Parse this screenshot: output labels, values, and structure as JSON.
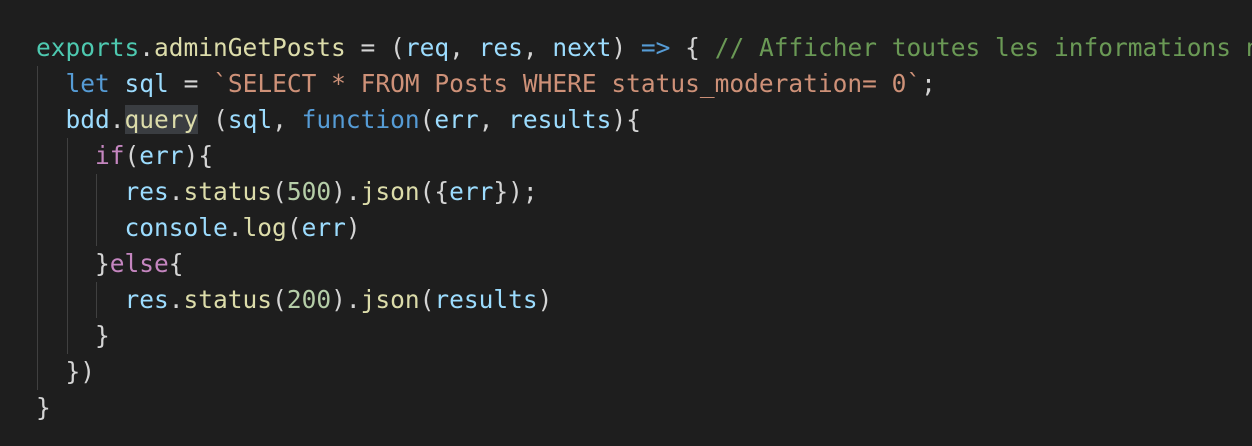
{
  "editor": {
    "background": "#1e1e1e",
    "indent_unit": "  ",
    "highlighted_token": "query",
    "lines": [
      {
        "indent": 0,
        "tokens": [
          {
            "t": "exports",
            "c": "obj"
          },
          {
            "t": ".",
            "c": "pun"
          },
          {
            "t": "adminGetPosts",
            "c": "fn"
          },
          {
            "t": " = (",
            "c": "pun"
          },
          {
            "t": "req",
            "c": "var"
          },
          {
            "t": ", ",
            "c": "pun"
          },
          {
            "t": "res",
            "c": "var"
          },
          {
            "t": ", ",
            "c": "pun"
          },
          {
            "t": "next",
            "c": "var"
          },
          {
            "t": ") ",
            "c": "pun"
          },
          {
            "t": "=>",
            "c": "kw"
          },
          {
            "t": " { ",
            "c": "pun"
          },
          {
            "t": "// Afficher toutes les informations ne",
            "c": "cm"
          }
        ]
      },
      {
        "indent": 1,
        "tokens": [
          {
            "t": "let",
            "c": "kw"
          },
          {
            "t": " ",
            "c": "pun"
          },
          {
            "t": "sql",
            "c": "var"
          },
          {
            "t": " = ",
            "c": "pun"
          },
          {
            "t": "`SELECT * FROM Posts WHERE status_moderation= 0`",
            "c": "str"
          },
          {
            "t": ";",
            "c": "pun"
          }
        ]
      },
      {
        "indent": 1,
        "tokens": [
          {
            "t": "bdd",
            "c": "var"
          },
          {
            "t": ".",
            "c": "pun"
          },
          {
            "t": "query",
            "c": "fn",
            "hl": true
          },
          {
            "t": " (",
            "c": "pun"
          },
          {
            "t": "sql",
            "c": "var"
          },
          {
            "t": ", ",
            "c": "pun"
          },
          {
            "t": "function",
            "c": "kw"
          },
          {
            "t": "(",
            "c": "pun"
          },
          {
            "t": "err",
            "c": "var"
          },
          {
            "t": ", ",
            "c": "pun"
          },
          {
            "t": "results",
            "c": "var"
          },
          {
            "t": "){",
            "c": "pun"
          }
        ]
      },
      {
        "indent": 2,
        "tokens": [
          {
            "t": "if",
            "c": "ctrl"
          },
          {
            "t": "(",
            "c": "pun"
          },
          {
            "t": "err",
            "c": "var"
          },
          {
            "t": "){",
            "c": "pun"
          }
        ]
      },
      {
        "indent": 3,
        "tokens": [
          {
            "t": "res",
            "c": "var"
          },
          {
            "t": ".",
            "c": "pun"
          },
          {
            "t": "status",
            "c": "fn"
          },
          {
            "t": "(",
            "c": "pun"
          },
          {
            "t": "500",
            "c": "num"
          },
          {
            "t": ").",
            "c": "pun"
          },
          {
            "t": "json",
            "c": "fn"
          },
          {
            "t": "({",
            "c": "pun"
          },
          {
            "t": "err",
            "c": "var"
          },
          {
            "t": "});",
            "c": "pun"
          }
        ]
      },
      {
        "indent": 3,
        "tokens": [
          {
            "t": "console",
            "c": "var"
          },
          {
            "t": ".",
            "c": "pun"
          },
          {
            "t": "log",
            "c": "fn"
          },
          {
            "t": "(",
            "c": "pun"
          },
          {
            "t": "err",
            "c": "var"
          },
          {
            "t": ")",
            "c": "pun"
          }
        ]
      },
      {
        "indent": 2,
        "tokens": [
          {
            "t": "}",
            "c": "pun"
          },
          {
            "t": "else",
            "c": "ctrl"
          },
          {
            "t": "{",
            "c": "pun"
          }
        ]
      },
      {
        "indent": 3,
        "tokens": [
          {
            "t": "res",
            "c": "var"
          },
          {
            "t": ".",
            "c": "pun"
          },
          {
            "t": "status",
            "c": "fn"
          },
          {
            "t": "(",
            "c": "pun"
          },
          {
            "t": "200",
            "c": "num"
          },
          {
            "t": ").",
            "c": "pun"
          },
          {
            "t": "json",
            "c": "fn"
          },
          {
            "t": "(",
            "c": "pun"
          },
          {
            "t": "results",
            "c": "var"
          },
          {
            "t": ")",
            "c": "pun"
          }
        ]
      },
      {
        "indent": 2,
        "tokens": [
          {
            "t": "}",
            "c": "pun"
          }
        ]
      },
      {
        "indent": 1,
        "tokens": [
          {
            "t": "})",
            "c": "pun"
          }
        ]
      },
      {
        "indent": 0,
        "tokens": [
          {
            "t": "}",
            "c": "pun"
          }
        ]
      }
    ],
    "guides": [
      {
        "depth": 0,
        "from_line": 1,
        "to_line": 9
      },
      {
        "depth": 1,
        "from_line": 3,
        "to_line": 8
      },
      {
        "depth": 2,
        "from_line": 4,
        "to_line": 5
      },
      {
        "depth": 2,
        "from_line": 7,
        "to_line": 7
      }
    ]
  }
}
